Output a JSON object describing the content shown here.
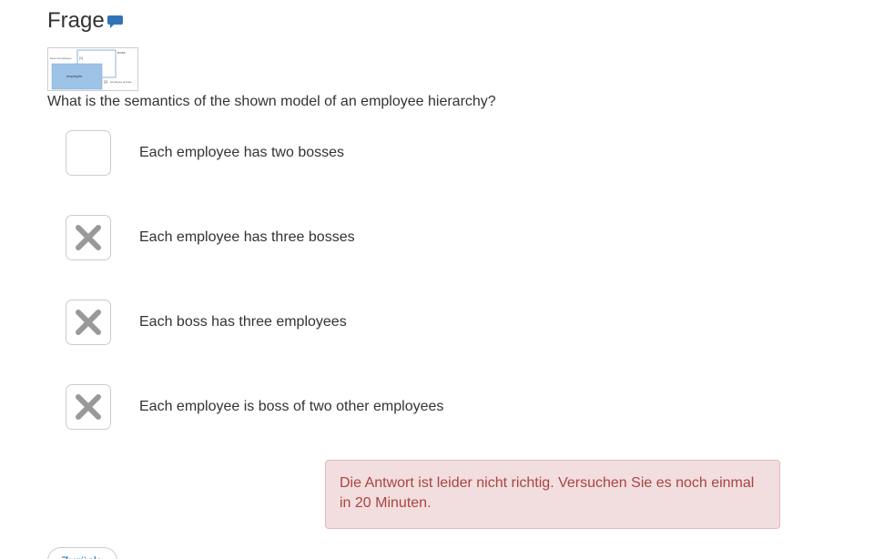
{
  "header": {
    "title": "Frage",
    "comment_icon": "comment-icon",
    "accent_color": "#3174b6"
  },
  "figure": {
    "label_boss": "boss",
    "label_boss_of": "boss of employee",
    "label_mult_top": "[1]",
    "label_employee": "employee",
    "label_mult_bottom": "[3]",
    "label_employee_of": "employee of boss",
    "employee_fill": "#9dc3e6"
  },
  "question": {
    "text": "What is the semantics of the shown model of an employee hierarchy?"
  },
  "options": [
    {
      "label": "Each employee has two bosses",
      "state": "empty"
    },
    {
      "label": "Each employee has three bosses",
      "state": "crossed"
    },
    {
      "label": "Each boss has three employees",
      "state": "crossed"
    },
    {
      "label": "Each employee is boss of two other employees",
      "state": "crossed"
    }
  ],
  "alert": {
    "text": "Die Antwort ist leider nicht richtig. Versuchen Sie es noch einmal in 20 Minuten.",
    "background": "#f2dede",
    "color": "#a94442"
  },
  "footer": {
    "back_label": "Zurück"
  }
}
